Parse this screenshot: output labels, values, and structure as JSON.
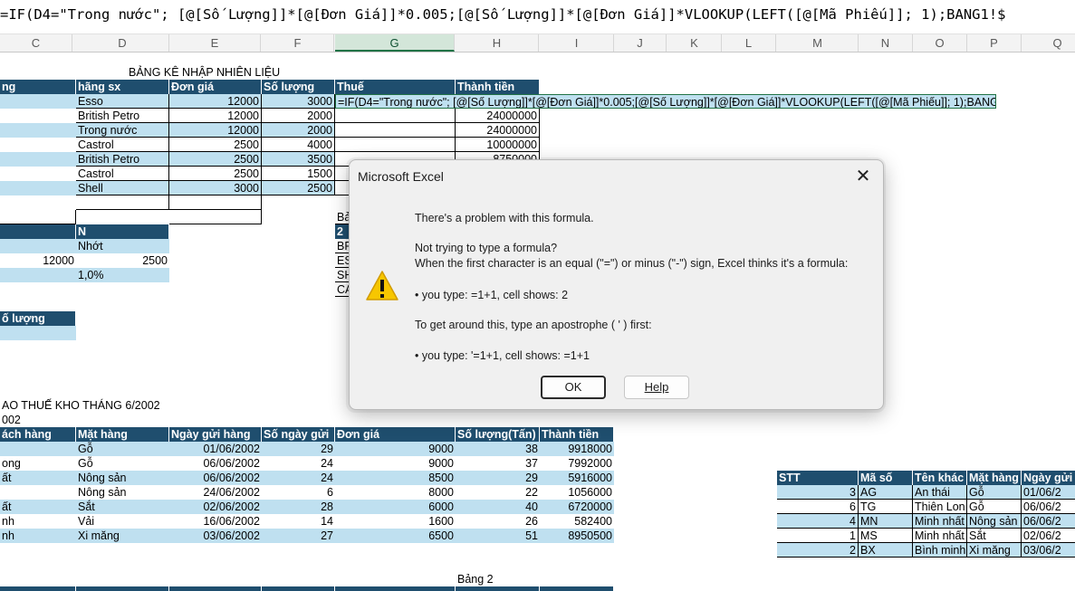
{
  "formula_bar": {
    "text": "=IF(D4=\"Trong nước\"; [@[Số Lượng]]*[@[Đơn Giá]]*0.005;[@[Số Lượng]]*[@[Đơn Giá]]*VLOOKUP(LEFT([@[Mã Phiếu]]; 1);BANG1!$"
  },
  "columns": [
    "C",
    "D",
    "E",
    "F",
    "G",
    "H",
    "I",
    "J",
    "K",
    "L",
    "M",
    "N",
    "O",
    "P",
    "Q"
  ],
  "sheet": {
    "title1": "BẢNG KÊ NHẬP NHIÊN LIỆU",
    "table1_headers": [
      "ng",
      "hãng sx",
      "Đơn giá",
      "Số lượng",
      "Thuế",
      "Thành tiền"
    ],
    "table1_rows": [
      {
        "hang": "Esso",
        "gia": "12000",
        "sl": "3000",
        "tt": ""
      },
      {
        "hang": "British Petro",
        "gia": "12000",
        "sl": "2000",
        "tt": "24000000"
      },
      {
        "hang": "Trong nước",
        "gia": "12000",
        "sl": "2000",
        "tt": "24000000"
      },
      {
        "hang": "Castrol",
        "gia": "2500",
        "sl": "4000",
        "tt": "10000000"
      },
      {
        "hang": "British Petro",
        "gia": "2500",
        "sl": "3500",
        "tt": "8750000"
      },
      {
        "hang": "Castrol",
        "gia": "2500",
        "sl": "1500",
        "tt": ""
      },
      {
        "hang": "Shell",
        "gia": "3000",
        "sl": "2500",
        "tt": ""
      }
    ],
    "editing_formula": "=IF(D4=\"Trong nước\"; [@[Số Lượng]]*[@[Đơn Giá]]*0.005;[@[Số Lượng]]*[@[Đơn Giá]]*VLOOKUP(LEFT([@[Mã Phiếu]]; 1);BANG1!$A$2:$",
    "small_table": {
      "header": "N",
      "r1": "Nhớt",
      "r2_a": "12000",
      "r2_b": "2500",
      "r3": "1,0%"
    },
    "so_luong_header": "ố lượng",
    "g_partial": [
      "Bả",
      "2",
      "BP",
      "ES",
      "SH",
      "CA"
    ],
    "title2": "AO THUẾ KHO THÁNG 6/2002",
    "title2_sub": "002",
    "table2_headers": [
      "ách hàng",
      "Mặt hàng",
      "Ngày gửi hàng",
      "Số ngày gửi",
      "Đơn giá",
      "Số lượng(Tấn)",
      "Thành tiền"
    ],
    "table2_rows": [
      {
        "kh": "",
        "mh": "Gỗ",
        "ngay": "01/06/2002",
        "sng": "29",
        "dg": "9000",
        "sl": "38",
        "tt": "9918000"
      },
      {
        "kh": "ong",
        "mh": "Gỗ",
        "ngay": "06/06/2002",
        "sng": "24",
        "dg": "9000",
        "sl": "37",
        "tt": "7992000"
      },
      {
        "kh": "ất",
        "mh": "Nông sản",
        "ngay": "06/06/2002",
        "sng": "24",
        "dg": "8500",
        "sl": "29",
        "tt": "5916000"
      },
      {
        "kh": "",
        "mh": "Nông sản",
        "ngay": "24/06/2002",
        "sng": "6",
        "dg": "8000",
        "sl": "22",
        "tt": "1056000"
      },
      {
        "kh": "ất",
        "mh": "Sắt",
        "ngay": "02/06/2002",
        "sng": "28",
        "dg": "6000",
        "sl": "40",
        "tt": "6720000"
      },
      {
        "kh": "nh",
        "mh": "Vải",
        "ngay": "16/06/2002",
        "sng": "14",
        "dg": "1600",
        "sl": "26",
        "tt": "582400"
      },
      {
        "kh": "nh",
        "mh": "Xi măng",
        "ngay": "03/06/2002",
        "sng": "27",
        "dg": "6500",
        "sl": "51",
        "tt": "8950500"
      }
    ],
    "bang2_label": "Bảng 2",
    "table3_headers": [
      "STT",
      "Mã số",
      "Tên khác",
      "Mặt hàng",
      "Ngày gửi"
    ],
    "table3_rows": [
      {
        "stt": "3",
        "ma": "AG",
        "ten": "An thái",
        "mh": "Gỗ",
        "ngay": "01/06/2"
      },
      {
        "stt": "6",
        "ma": "TG",
        "ten": "Thiên Lon",
        "mh": "Gỗ",
        "ngay": "06/06/2"
      },
      {
        "stt": "4",
        "ma": "MN",
        "ten": "Minh nhất",
        "mh": "Nông sản",
        "ngay": "06/06/2"
      },
      {
        "stt": "1",
        "ma": "MS",
        "ten": "Minh nhất",
        "mh": "Sắt",
        "ngay": "02/06/2"
      },
      {
        "stt": "2",
        "ma": "BX",
        "ten": "Bình minh",
        "mh": "Xi măng",
        "ngay": "03/06/2"
      }
    ]
  },
  "dialog": {
    "title": "Microsoft Excel",
    "line1": "There's a problem with this formula.",
    "line2": "Not trying to type a formula?",
    "line3": "When the first character is an equal (\"=\") or minus (\"-\") sign, Excel thinks it's a formula:",
    "line4": "• you type:   =1+1, cell shows:   2",
    "line5": "To get around this, type an apostrophe ( ' ) first:",
    "line6": "• you type:   '=1+1, cell shows:   =1+1",
    "ok_label": "OK",
    "help_label": "Help",
    "icon": "warning-icon"
  }
}
